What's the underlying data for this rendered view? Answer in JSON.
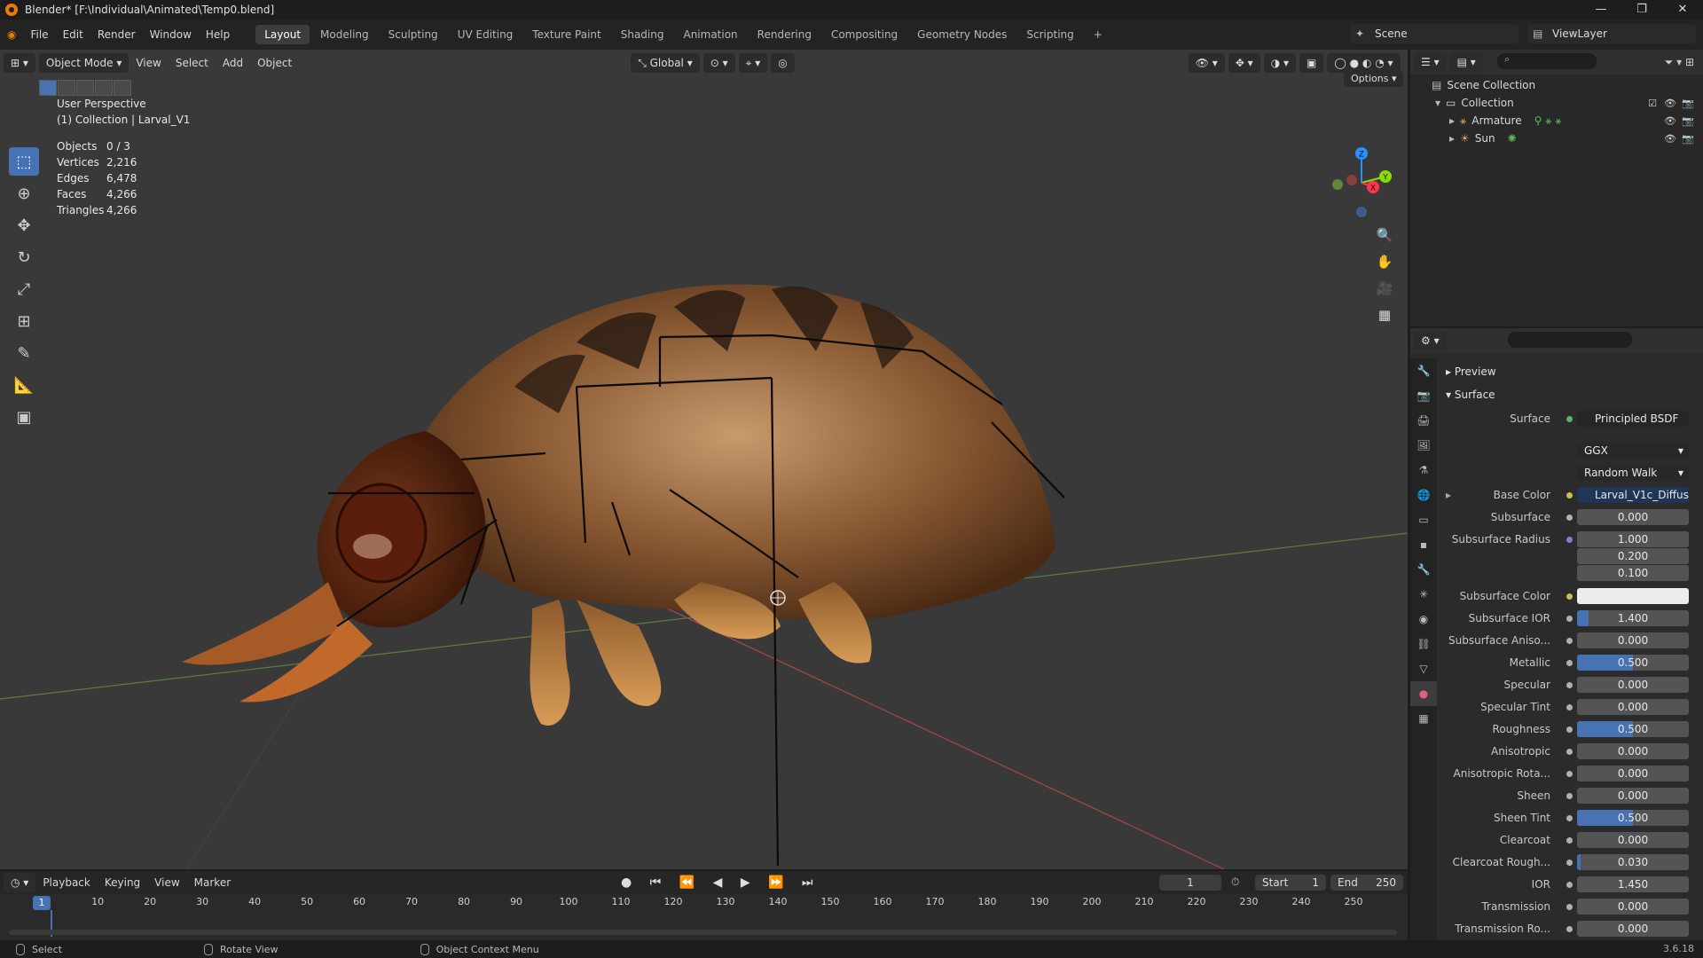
{
  "window": {
    "title": "Blender* [F:\\Individual\\Animated\\Temp0.blend]",
    "buttons": [
      "—",
      "❐",
      "✕"
    ]
  },
  "menubar": {
    "menus": [
      "File",
      "Edit",
      "Render",
      "Window",
      "Help"
    ],
    "workspaces": [
      "Layout",
      "Modeling",
      "Sculpting",
      "UV Editing",
      "Texture Paint",
      "Shading",
      "Animation",
      "Rendering",
      "Compositing",
      "Geometry Nodes",
      "Scripting"
    ],
    "active_workspace": "Layout",
    "add_tab": "+",
    "scene": "Scene",
    "view_layer": "ViewLayer"
  },
  "viewport": {
    "mode": "Object Mode",
    "menus": [
      "View",
      "Select",
      "Add",
      "Object"
    ],
    "transform_orientation": "Global",
    "options_label": "Options",
    "perspective": "User Perspective",
    "collection_info": "(1) Collection | Larval_V1",
    "stats": [
      {
        "label": "Objects",
        "value": "0 / 3"
      },
      {
        "label": "Vertices",
        "value": "2,216"
      },
      {
        "label": "Edges",
        "value": "6,478"
      },
      {
        "label": "Faces",
        "value": "4,266"
      },
      {
        "label": "Triangles",
        "value": "4,266"
      }
    ],
    "gizmo_axes": [
      "X",
      "Y",
      "Z"
    ]
  },
  "outliner": {
    "root": "Scene Collection",
    "collection": "Collection",
    "objects": [
      {
        "name": "Armature",
        "icon": "armature-icon"
      },
      {
        "name": "Sun",
        "icon": "sun-icon"
      }
    ]
  },
  "properties": {
    "panels": {
      "preview": "Preview",
      "surface": "Surface"
    },
    "surface_shader": "Principled BSDF",
    "distribution": "GGX",
    "subsurface_method": "Random Walk",
    "base_color_texture": "Larval_V1c_Diffuse",
    "rows": [
      {
        "label": "Subsurface",
        "value": "0.000",
        "fill": 0
      },
      {
        "label": "Subsurface Radius",
        "value": "1.000",
        "fill": 0
      },
      {
        "label": "",
        "value": "0.200",
        "fill": 0
      },
      {
        "label": "",
        "value": "0.100",
        "fill": 0
      }
    ],
    "subsurface_color_label": "Subsurface Color",
    "rows2": [
      {
        "label": "Subsurface IOR",
        "value": "1.400",
        "fill": 0.1
      },
      {
        "label": "Subsurface Aniso...",
        "value": "0.000",
        "fill": 0
      },
      {
        "label": "Metallic",
        "value": "0.500",
        "fill": 0.5
      },
      {
        "label": "Specular",
        "value": "0.000",
        "fill": 0
      },
      {
        "label": "Specular Tint",
        "value": "0.000",
        "fill": 0
      },
      {
        "label": "Roughness",
        "value": "0.500",
        "fill": 0.5
      },
      {
        "label": "Anisotropic",
        "value": "0.000",
        "fill": 0
      },
      {
        "label": "Anisotropic Rota...",
        "value": "0.000",
        "fill": 0
      },
      {
        "label": "Sheen",
        "value": "0.000",
        "fill": 0
      },
      {
        "label": "Sheen Tint",
        "value": "0.500",
        "fill": 0.5
      },
      {
        "label": "Clearcoat",
        "value": "0.000",
        "fill": 0
      },
      {
        "label": "Clearcoat Rough...",
        "value": "0.030",
        "fill": 0.03
      },
      {
        "label": "IOR",
        "value": "1.450",
        "fill": 0
      },
      {
        "label": "Transmission",
        "value": "0.000",
        "fill": 0
      },
      {
        "label": "Transmission Ro...",
        "value": "0.000",
        "fill": 0
      }
    ],
    "labels": {
      "surface": "Surface",
      "base_color": "Base Color"
    }
  },
  "timeline": {
    "menus": [
      "Playback",
      "Keying",
      "View",
      "Marker"
    ],
    "current_frame": "1",
    "start_label": "Start",
    "start": "1",
    "end_label": "End",
    "end": "250",
    "ticks": [
      "1",
      "10",
      "20",
      "30",
      "40",
      "50",
      "60",
      "70",
      "80",
      "90",
      "100",
      "110",
      "120",
      "130",
      "140",
      "150",
      "160",
      "170",
      "180",
      "190",
      "200",
      "210",
      "220",
      "230",
      "240",
      "250"
    ]
  },
  "statusbar": {
    "items": [
      "Select",
      "Rotate View",
      "Object Context Menu"
    ],
    "version": "3.6.18"
  },
  "colors": {
    "accent": "#4772b3",
    "brand": "#e87d0d",
    "x_axis": "#ff3352",
    "y_axis": "#8bdc00",
    "z_axis": "#2890ff"
  }
}
